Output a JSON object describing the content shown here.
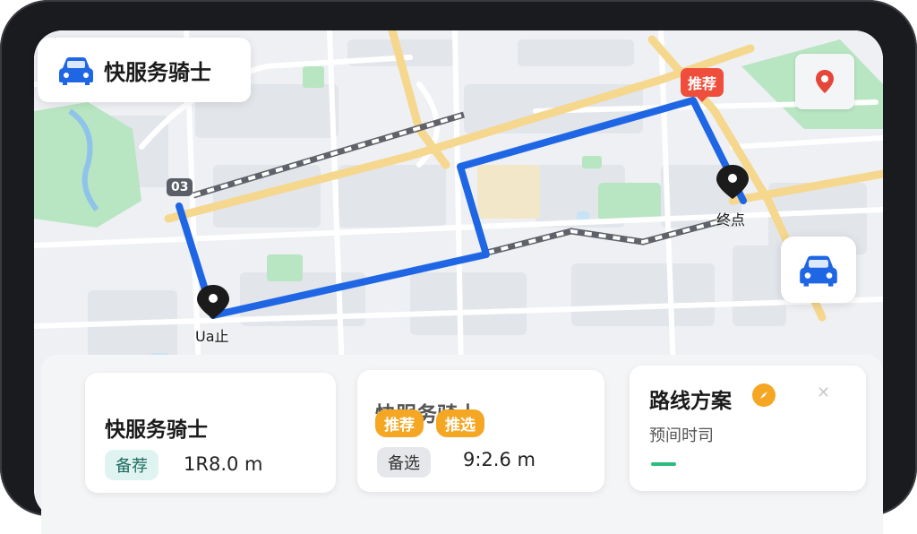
{
  "app": {
    "title": "快服务骑士"
  },
  "map": {
    "route_badge": "推荐",
    "start_tag": "03",
    "start_label": "Ua止",
    "end_label": "终点",
    "colors": {
      "route": "#1f66e5",
      "alt_route": "#5f6268",
      "road_main": "#f5d78e",
      "park": "#b8e5c2",
      "water": "#c7e3f6"
    }
  },
  "cards": [
    {
      "title": "快服务骑士",
      "tag": "备荐",
      "distance": "1R8.0 m"
    },
    {
      "title": "快服务骑士",
      "badge_primary": "推荐",
      "badge_secondary": "推选",
      "tag": "备选",
      "distance": "9:2.6 m"
    },
    {
      "title": "路线方案",
      "subtitle": "预间时司"
    }
  ],
  "icons": {
    "top_car": "car-icon",
    "location_pin": "location-pin-icon",
    "locate_car": "car-icon",
    "compass": "compass-icon"
  }
}
